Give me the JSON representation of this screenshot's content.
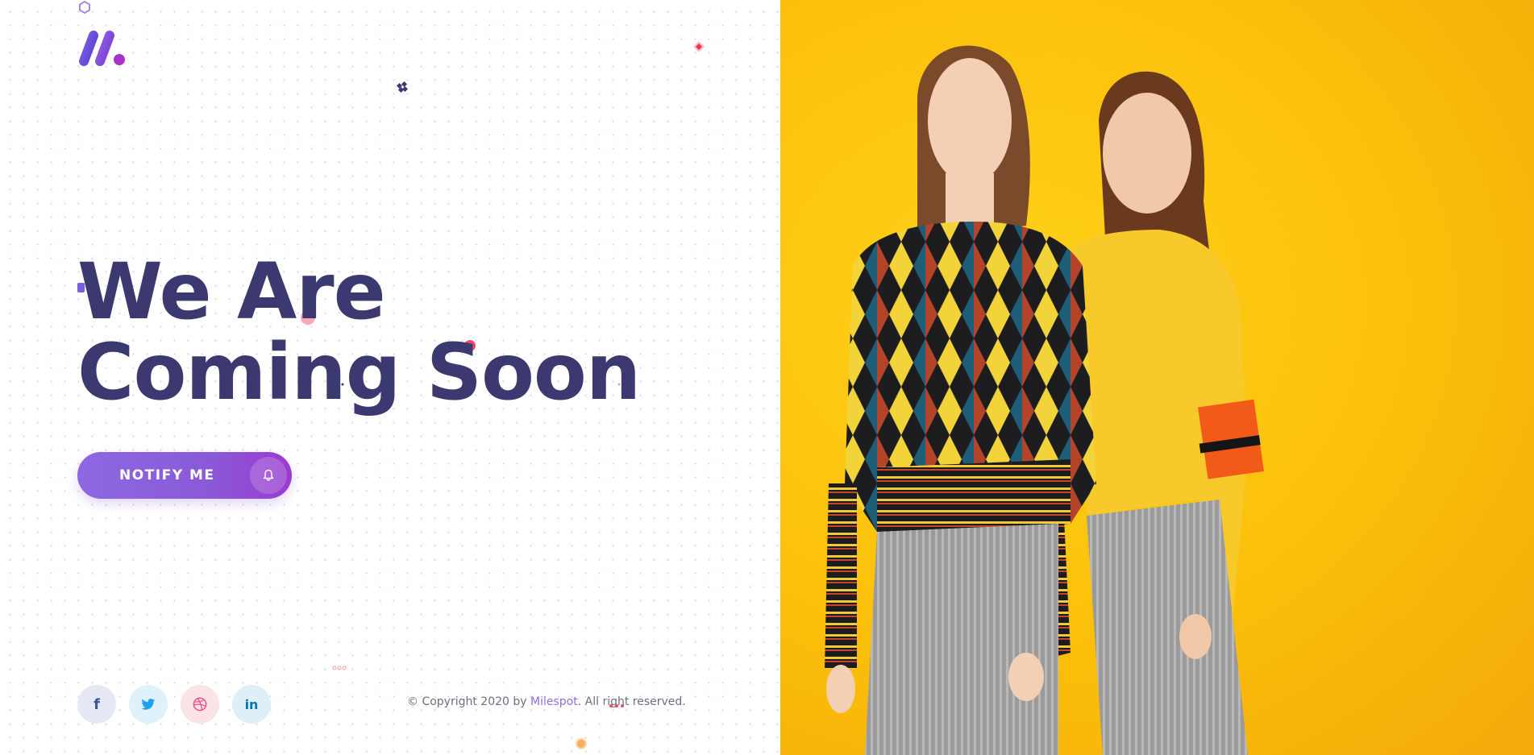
{
  "headline": {
    "line1": "We Are",
    "line2": "Coming Soon"
  },
  "notify_button": {
    "label": "NOTIFY ME",
    "icon": "bell-icon"
  },
  "social": [
    {
      "name": "facebook",
      "icon": "facebook-icon",
      "glyph": "f",
      "color": "#3b5998"
    },
    {
      "name": "twitter",
      "icon": "twitter-icon",
      "color": "#1da1f2"
    },
    {
      "name": "dribbble",
      "icon": "dribbble-icon",
      "color": "#ea4c89"
    },
    {
      "name": "linkedin",
      "icon": "linkedin-icon",
      "glyph": "in",
      "color": "#0077b5"
    }
  ],
  "footer": {
    "copyright_prefix": "© Copyright 2020 by ",
    "brand_link": "Milespot",
    "copyright_suffix": ". All right reserved."
  },
  "colors": {
    "heading": "#3b3970",
    "accent": "#8c6ee0",
    "button_gradient_start": "#8d68e2",
    "button_gradient_end": "#9a3bd0",
    "hero_background": "#fbbf0a"
  },
  "hero_image": {
    "description_icon": "fashion-models-photo"
  }
}
